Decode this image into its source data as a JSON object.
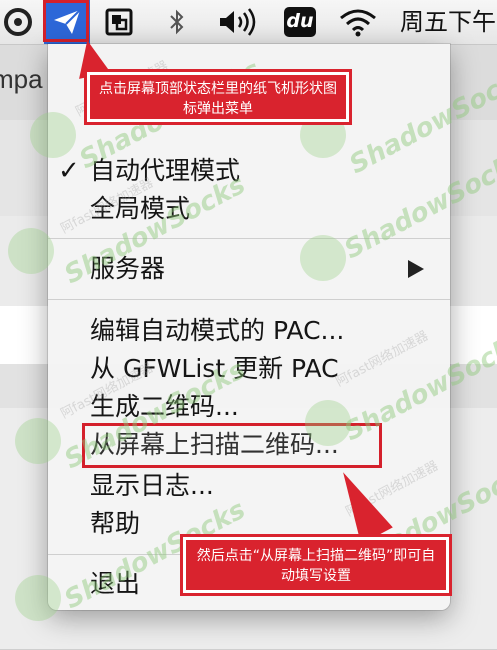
{
  "menubar": {
    "clock": "周五下午",
    "icons": [
      "app-circle-icon",
      "paper-plane-icon",
      "window-restore-icon",
      "bluetooth-icon",
      "volume-icon",
      "baidu-du-icon",
      "wifi-icon"
    ],
    "du_label": "du"
  },
  "background_app": {
    "title_fragment": "mpa"
  },
  "menu": {
    "items": [
      {
        "label": "自动代理模式",
        "checked": true
      },
      {
        "label": "全局模式",
        "checked": false
      },
      {
        "label": "服务器",
        "submenu": true
      },
      {
        "label": "编辑自动模式的 PAC..."
      },
      {
        "label": "从 GFWList 更新 PAC"
      },
      {
        "label": "生成二维码..."
      },
      {
        "label": "从屏幕上扫描二维码..."
      },
      {
        "label": "显示日志..."
      },
      {
        "label": "帮助"
      },
      {
        "label": "退出"
      }
    ],
    "check_mark": "✓"
  },
  "annotations": {
    "callout1": "点击屏幕顶部状态栏里的纸飞机形状图标弹出菜单",
    "callout2": "然后点击“从屏幕上扫描二维码”即可自动填写设置"
  },
  "watermark": {
    "brand": "ShadowSocks",
    "sub": "阿fast网络加速器"
  },
  "colors": {
    "accent_blue": "#2d67d8",
    "annotation_red": "#d9232e",
    "watermark_green": "#8cc878"
  }
}
